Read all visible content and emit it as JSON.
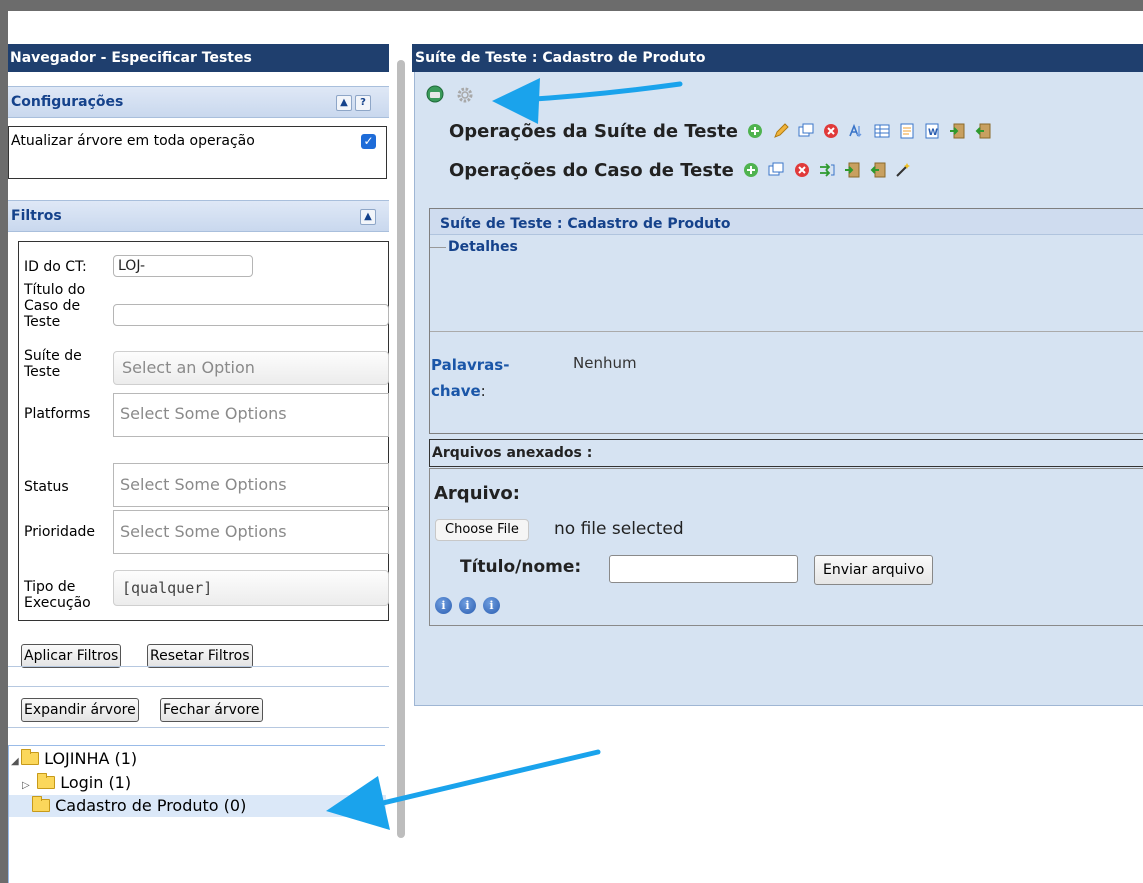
{
  "left": {
    "title": "Navegador - Especificar Testes",
    "config": {
      "header": "Configurações",
      "collapse_btn": "▲",
      "help_btn": "?",
      "update_tree_label": "Atualizar árvore em toda operação",
      "update_tree_checked": true
    },
    "filters": {
      "header": "Filtros",
      "collapse_btn": "▲",
      "tc_id_label": "ID do CT:",
      "tc_id_value": "LOJ-",
      "tc_title_label": "Título do Caso de Teste",
      "suite_label": "Suíte de Teste",
      "suite_placeholder": "Select an Option",
      "platforms_label": "Platforms",
      "platforms_placeholder": "Select Some Options",
      "status_label": "Status",
      "status_placeholder": "Select Some Options",
      "priority_label": "Prioridade",
      "priority_placeholder": "Select Some Options",
      "exec_type_label": "Tipo de Execução",
      "exec_type_value": "[qualquer]",
      "apply_btn": "Aplicar Filtros",
      "reset_btn": "Resetar Filtros"
    },
    "tree_buttons": {
      "expand": "Expandir árvore",
      "collapse": "Fechar árvore"
    },
    "tree": {
      "root": "LOJINHA (1)",
      "children": [
        "Login (1)",
        "Cadastro de Produto (0)"
      ]
    }
  },
  "right": {
    "title": "Suíte de Teste : Cadastro de Produto",
    "suite_ops_label": "Operações da Suíte de Teste",
    "case_ops_label": "Operações do Caso de Teste",
    "suite_box_title": "Suíte de Teste : Cadastro de Produto",
    "details_label": "Detalhes",
    "keywords_label_1": "Palavras-",
    "keywords_label_2": "chave",
    "keywords_colon": ":",
    "keywords_value": "Nenhum",
    "attachments_title": "Arquivos anexados :",
    "file_label": "Arquivo:",
    "choose_file_btn": "Choose File",
    "no_file_text": "no file selected",
    "title_name_label": "Título/nome:",
    "send_btn": "Enviar arquivo",
    "info_icons": [
      "i",
      "i",
      "i"
    ]
  },
  "colors": {
    "header_bg": "#1f3f6e",
    "panel_bg": "#d6e3f2",
    "section_text": "#15428b",
    "arrow": "#1aa3ec"
  }
}
